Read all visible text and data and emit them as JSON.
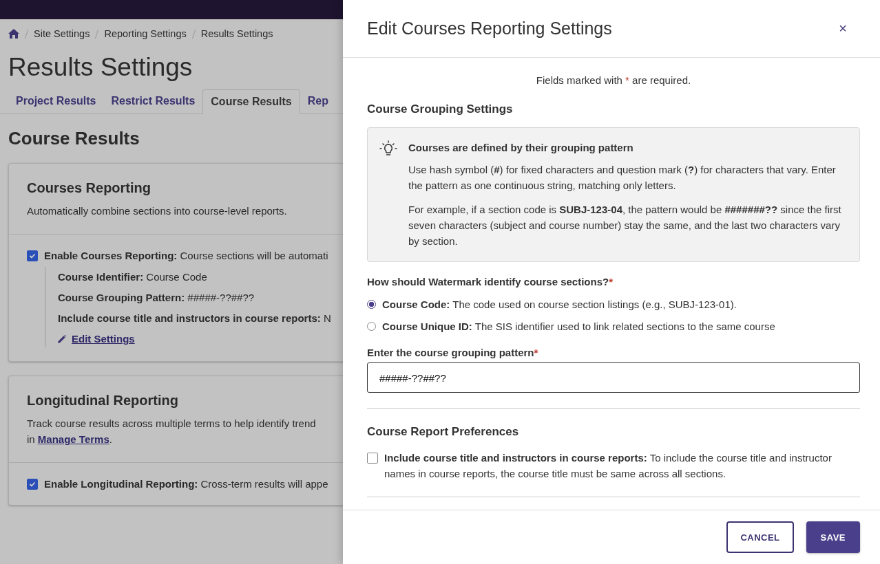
{
  "breadcrumb": [
    "Site Settings",
    "Reporting Settings",
    "Results Settings"
  ],
  "page_title": "Results Settings",
  "tabs": [
    {
      "label": "Project Results",
      "selected": false
    },
    {
      "label": "Restrict Results",
      "selected": false
    },
    {
      "label": "Course Results",
      "selected": true
    },
    {
      "label": "Rep",
      "selected": false
    }
  ],
  "section_title": "Course Results",
  "courses_card": {
    "title": "Courses Reporting",
    "description": "Automatically combine sections into course-level reports.",
    "setting": {
      "label": "Enable Courses Reporting:",
      "text": "Course sections will be automati",
      "checked": true
    },
    "details": [
      {
        "label": "Course Identifier:",
        "value": "Course Code"
      },
      {
        "label": "Course Grouping Pattern:",
        "value": "#####-??##??"
      },
      {
        "label": "Include course title and instructors in course reports:",
        "value": "N"
      }
    ],
    "edit_link": "Edit Settings"
  },
  "longitudinal_card": {
    "title": "Longitudinal Reporting",
    "description": "Track course results across multiple terms to help identify trend",
    "description_prefix": "in",
    "link": "Manage Terms",
    "description_suffix": ".",
    "setting": {
      "label": "Enable Longitudinal Reporting:",
      "text": "Cross-term results will appe",
      "checked": true
    }
  },
  "drawer": {
    "title": "Edit Courses Reporting Settings",
    "close": "×",
    "required_note": {
      "before": "Fields marked with",
      "mark": "*",
      "after": "are required."
    },
    "grouping_heading": "Course Grouping Settings",
    "tip": {
      "title": "Courses are defined by their grouping pattern",
      "paragraphs": [
        "Use hash symbol (**#**) for fixed characters and question mark (**?**) for characters that vary. Enter the pattern as one continuous string, matching only letters.",
        "For example, if a section code is **SUBJ-123-04**, the pattern would be **#######??** since the first seven characters (subject and course number) stay the same, and the last two characters vary by section."
      ]
    },
    "question": {
      "label": "How should Watermark identify course sections?",
      "required_mark": "*"
    },
    "radios": [
      {
        "label": "Course Code:",
        "description": "The code used on course section listings (e.g., SUBJ-123-01).",
        "selected": true
      },
      {
        "label": "Course Unique ID:",
        "description": "The SIS identifier used to link related sections to the same course",
        "selected": false
      }
    ],
    "pattern_field": {
      "label": "Enter the course grouping pattern",
      "required_mark": "*",
      "value": "#####-??##??"
    },
    "preferences_heading": "Course Report Preferences",
    "preference": {
      "label": "Include course title and instructors in course reports:",
      "description": "To include the course title and instructor names in course reports, the course title must be same across all sections.",
      "checked": false
    },
    "buttons": [
      {
        "label": "CANCEL",
        "kind": "secondary"
      },
      {
        "label": "SAVE",
        "kind": "primary"
      }
    ]
  }
}
